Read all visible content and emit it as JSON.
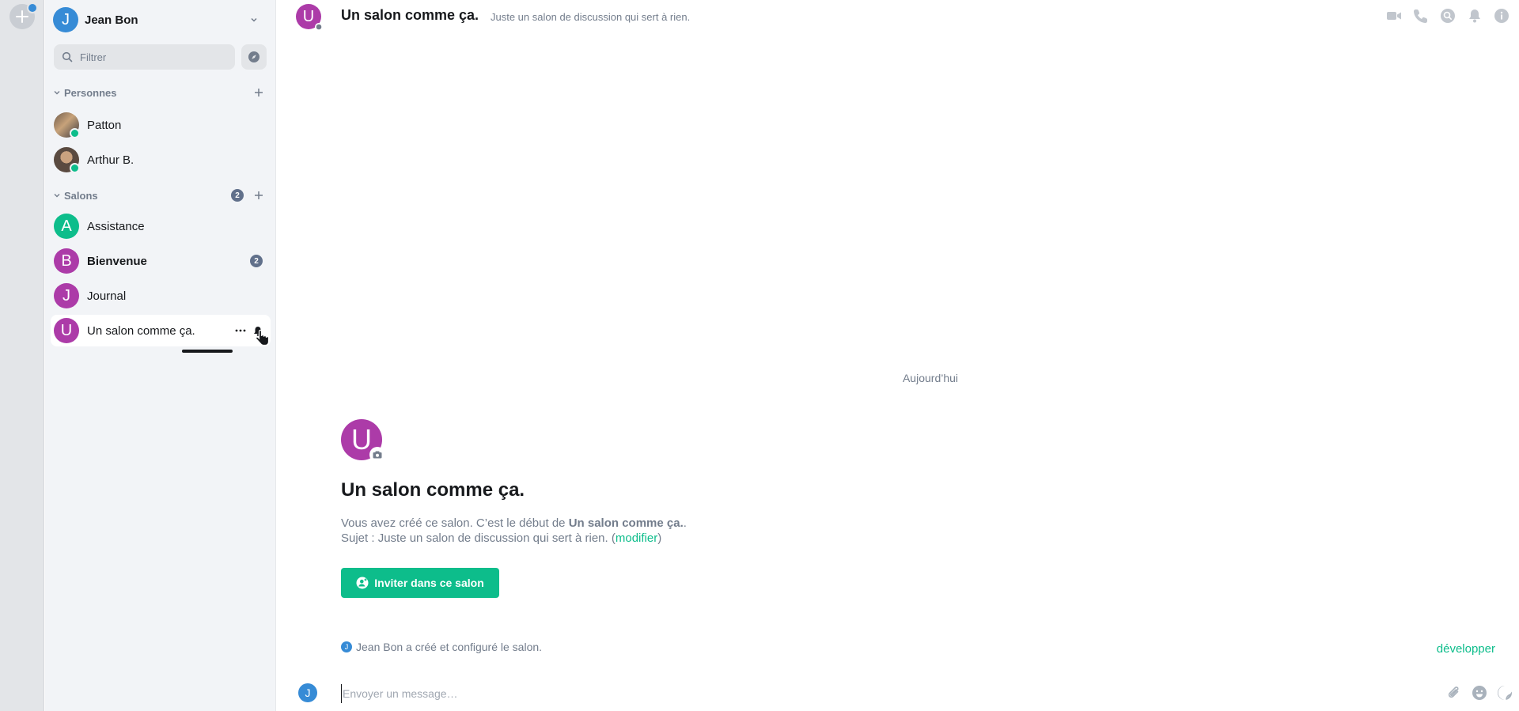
{
  "user": {
    "name": "Jean Bon",
    "initial": "J"
  },
  "filter": {
    "placeholder": "Filtrer"
  },
  "sections": {
    "people": {
      "label": "Personnes"
    },
    "rooms": {
      "label": "Salons",
      "count": "2"
    }
  },
  "people": [
    {
      "name": "Patton"
    },
    {
      "name": "Arthur B."
    }
  ],
  "rooms": [
    {
      "name": "Assistance",
      "initial": "A",
      "color": "#0dbd8b"
    },
    {
      "name": "Bienvenue",
      "initial": "B",
      "color": "#ac3ba8",
      "badge": "2"
    },
    {
      "name": "Journal",
      "initial": "J",
      "color": "#ac3ba8"
    },
    {
      "name": "Un salon comme ça.",
      "initial": "U",
      "color": "#ac3ba8"
    }
  ],
  "header": {
    "initial": "U",
    "title": "Un salon comme ça.",
    "topic": "Juste un salon de discussion qui sert à rien."
  },
  "timeline": {
    "date_separator": "Aujourd’hui",
    "intro_initial": "U",
    "intro_title": "Un salon comme ça.",
    "intro_line1_prefix": "Vous avez créé ce salon. C’est le début de ",
    "intro_line1_room": "Un salon comme ça.",
    "intro_line1_suffix": ".",
    "intro_line2_prefix": "Sujet : Juste un salon de discussion qui sert à rien. (",
    "intro_line2_link": "modifier",
    "intro_line2_suffix": ")",
    "invite_label": "Inviter dans ce salon",
    "event_initial": "J",
    "event_text": "Jean Bon a créé et configuré le salon.",
    "expand_label": "développer"
  },
  "composer": {
    "initial": "J",
    "placeholder": "Envoyer un message…"
  },
  "colors": {
    "accent": "#0dbd8b",
    "room_avatar": "#ac3ba8",
    "user_avatar": "#368bd6",
    "muted": "#737d8c"
  }
}
